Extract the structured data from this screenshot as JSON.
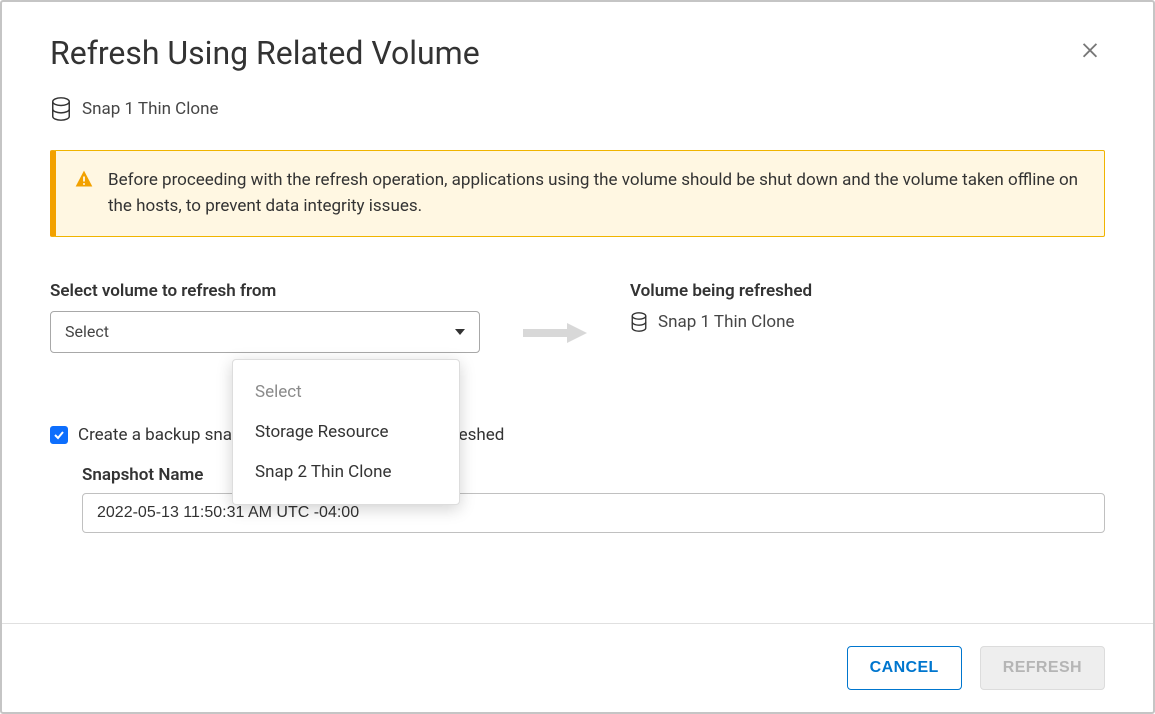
{
  "header": {
    "title": "Refresh Using Related Volume"
  },
  "subheader": {
    "volume_name": "Snap 1 Thin Clone"
  },
  "warning": {
    "text": "Before proceeding with the refresh operation, applications using the volume should be shut down and the volume taken offline on the hosts, to prevent data integrity issues."
  },
  "left": {
    "label": "Select volume to refresh from",
    "selected": "Select",
    "options": [
      "Select",
      "Storage Resource",
      "Snap 2 Thin Clone"
    ]
  },
  "right": {
    "label": "Volume being refreshed",
    "volume_name": "Snap 1 Thin Clone"
  },
  "backup": {
    "checkbox_label": "Create a backup snapshot of the volume being refreshed",
    "checked": true,
    "snapshot_label": "Snapshot Name",
    "snapshot_value": "2022-05-13 11:50:31 AM UTC -04:00"
  },
  "footer": {
    "cancel": "CANCEL",
    "refresh": "REFRESH"
  }
}
